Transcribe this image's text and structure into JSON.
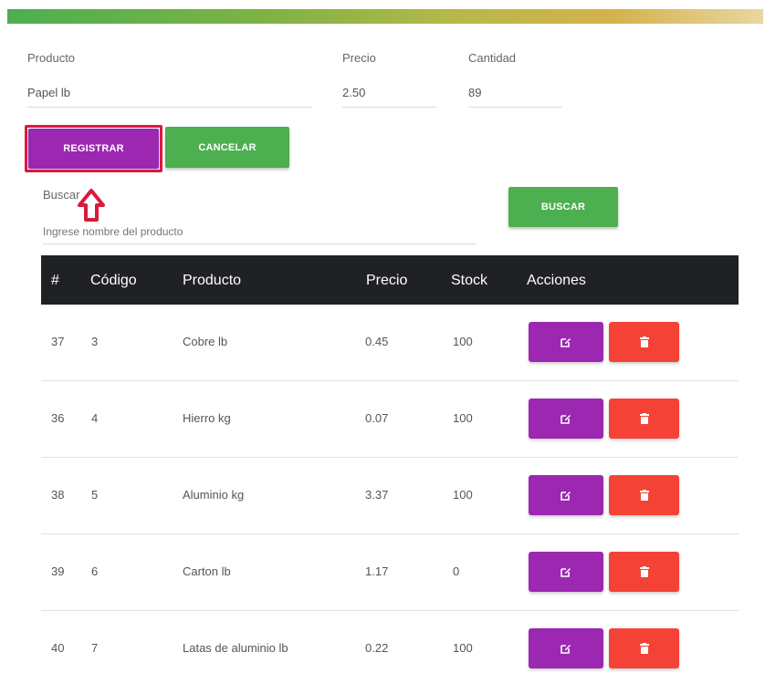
{
  "form": {
    "producto_label": "Producto",
    "producto_value": "Papel lb",
    "precio_label": "Precio",
    "precio_value": "2.50",
    "cantidad_label": "Cantidad",
    "cantidad_value": "89",
    "register_label": "REGISTRAR",
    "cancel_label": "CANCELAR"
  },
  "search": {
    "label": "Buscar",
    "placeholder": "Ingrese nombre del producto",
    "button_label": "BUSCAR"
  },
  "table": {
    "headers": [
      "#",
      "Código",
      "Producto",
      "Precio",
      "Stock",
      "Acciones"
    ],
    "rows": [
      {
        "id": "37",
        "codigo": "3",
        "producto": "Cobre lb",
        "precio": "0.45",
        "stock": "100"
      },
      {
        "id": "36",
        "codigo": "4",
        "producto": "Hierro kg",
        "precio": "0.07",
        "stock": "100"
      },
      {
        "id": "38",
        "codigo": "5",
        "producto": "Aluminio kg",
        "precio": "3.37",
        "stock": "100"
      },
      {
        "id": "39",
        "codigo": "6",
        "producto": "Carton lb",
        "precio": "1.17",
        "stock": "0"
      },
      {
        "id": "40",
        "codigo": "7",
        "producto": "Latas de aluminio lb",
        "precio": "0.22",
        "stock": "100"
      }
    ]
  },
  "icons": {
    "edit": "edit-icon",
    "delete": "trash-icon",
    "annotation": "arrow-up-icon"
  },
  "colors": {
    "purple": "#9c27b0",
    "green": "#4caf50",
    "red": "#f44336",
    "header_dark": "#202124",
    "highlight": "#d81b3a"
  }
}
